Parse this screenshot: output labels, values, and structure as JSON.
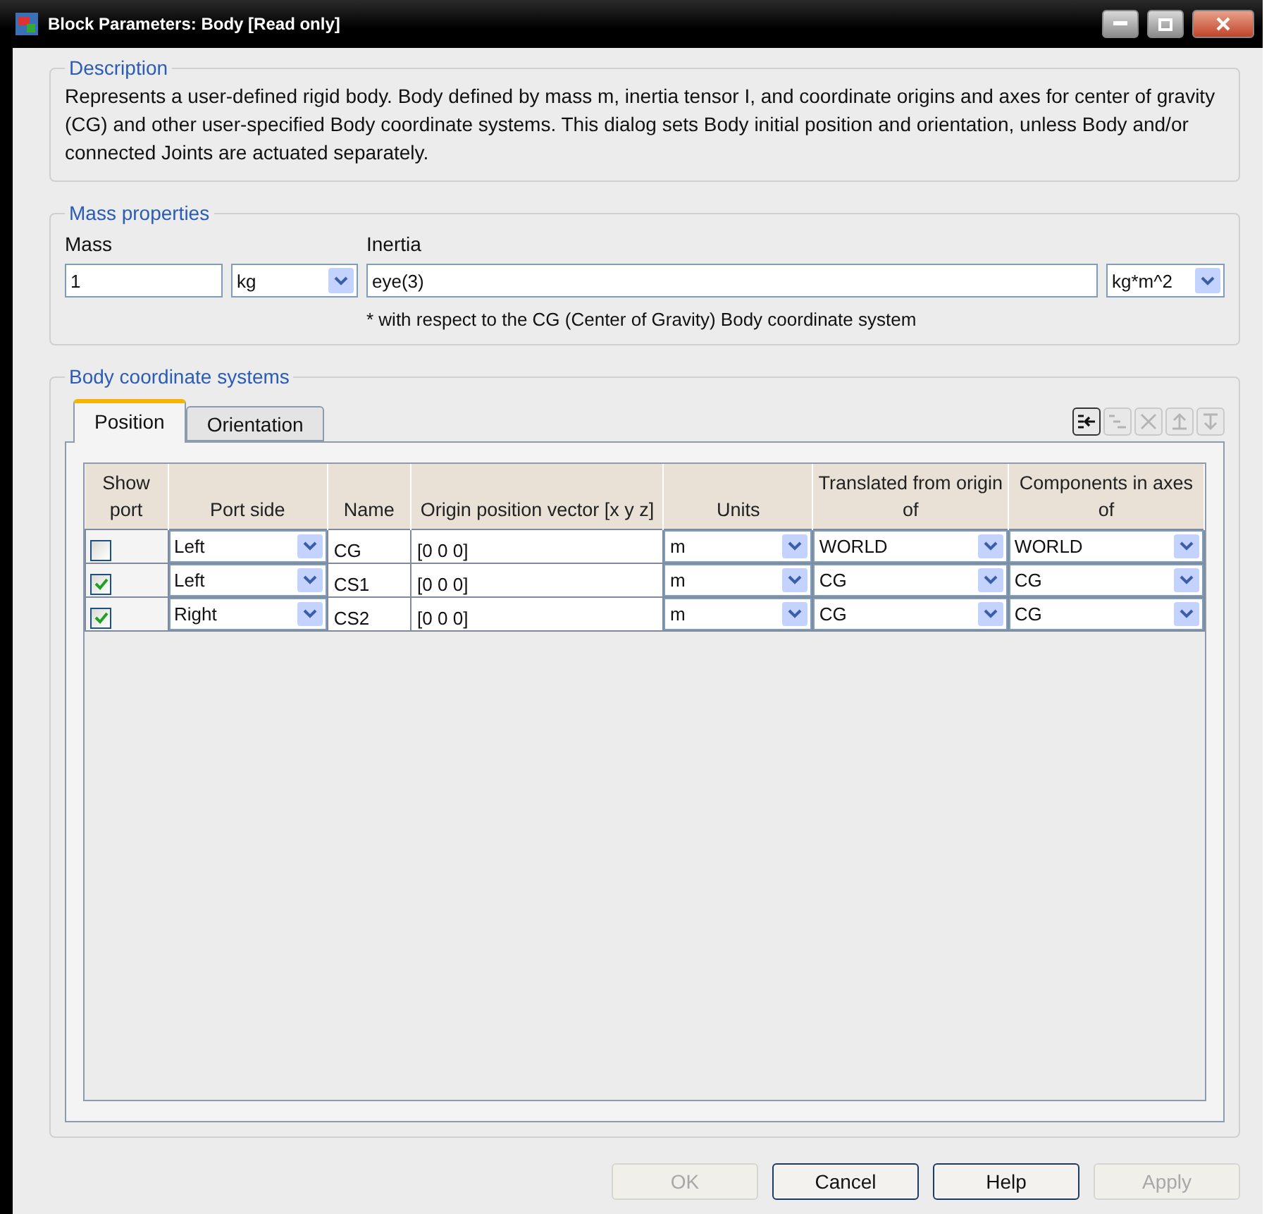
{
  "window": {
    "title": "Block Parameters: Body  [Read only]"
  },
  "description": {
    "legend": "Description",
    "text": "Represents a user-defined rigid body. Body defined by mass m, inertia tensor I, and coordinate origins and axes for center of gravity (CG) and other user-specified Body coordinate systems. This dialog sets Body initial position and orientation, unless Body and/or connected Joints are actuated separately."
  },
  "mass_properties": {
    "legend": "Mass properties",
    "mass_label": "Mass",
    "mass_value": "1",
    "mass_unit": "kg",
    "inertia_label": "Inertia",
    "inertia_value": "eye(3)",
    "inertia_unit": "kg*m^2",
    "note": "* with respect to the CG (Center of Gravity) Body coordinate system"
  },
  "body_coordinate_systems": {
    "legend": "Body coordinate systems",
    "tabs": [
      {
        "label": "Position",
        "selected": true
      },
      {
        "label": "Orientation",
        "selected": false
      }
    ],
    "toolbar": [
      {
        "kind": "add",
        "disabled": false
      },
      {
        "kind": "indent",
        "disabled": true
      },
      {
        "kind": "delete",
        "disabled": true
      },
      {
        "kind": "up",
        "disabled": true
      },
      {
        "kind": "down",
        "disabled": true
      }
    ],
    "columns": [
      "Show port",
      "Port side",
      "Name",
      "Origin position vector [x y z]",
      "Units",
      "Translated from origin of",
      "Components in axes of"
    ],
    "rows": [
      {
        "show_port": false,
        "port_side": "Left",
        "name": "CG",
        "origin": "[0 0 0]",
        "units": "m",
        "translated_from": "WORLD",
        "components_in": "WORLD"
      },
      {
        "show_port": true,
        "port_side": "Left",
        "name": "CS1",
        "origin": "[0 0 0]",
        "units": "m",
        "translated_from": "CG",
        "components_in": "CG"
      },
      {
        "show_port": true,
        "port_side": "Right",
        "name": "CS2",
        "origin": "[0 0 0]",
        "units": "m",
        "translated_from": "CG",
        "components_in": "CG"
      }
    ]
  },
  "buttons": [
    {
      "label": "OK",
      "disabled": true
    },
    {
      "label": "Cancel",
      "disabled": false
    },
    {
      "label": "Help",
      "disabled": false
    },
    {
      "label": "Apply",
      "disabled": true
    }
  ]
}
